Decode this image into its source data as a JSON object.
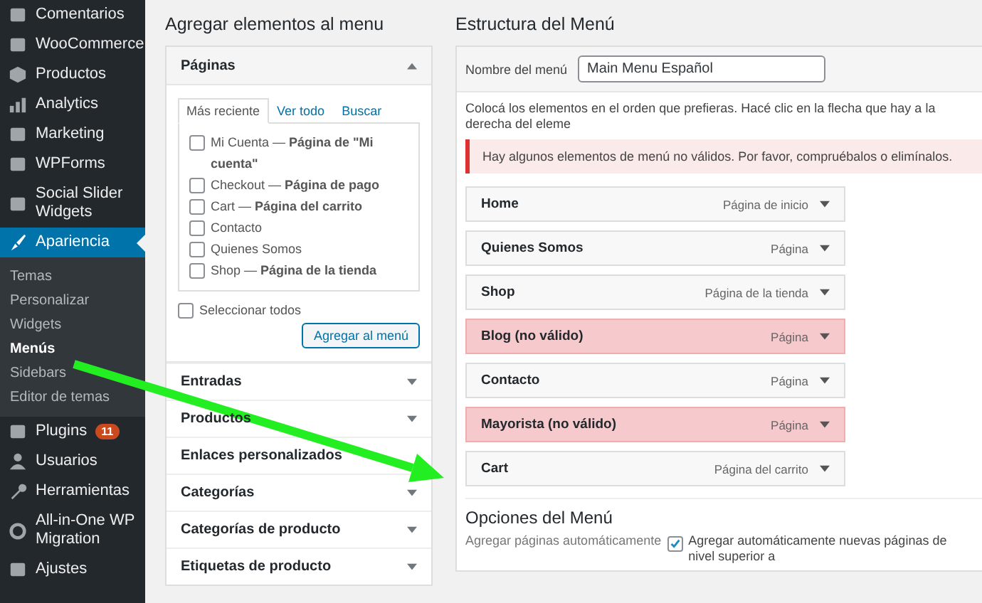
{
  "sidebar": {
    "items": [
      {
        "label": "Comentarios",
        "selected": false
      },
      {
        "label": "WooCommerce",
        "selected": false
      },
      {
        "label": "Productos",
        "selected": false
      },
      {
        "label": "Analytics",
        "selected": false
      },
      {
        "label": "Marketing",
        "selected": false
      },
      {
        "label": "WPForms",
        "selected": false
      },
      {
        "label": "Social Slider Widgets",
        "selected": false
      },
      {
        "label": "Apariencia",
        "selected": true,
        "children": [
          {
            "label": "Temas",
            "selected": false
          },
          {
            "label": "Personalizar",
            "selected": false
          },
          {
            "label": "Widgets",
            "selected": false
          },
          {
            "label": "Menús",
            "selected": true
          },
          {
            "label": "Sidebars",
            "selected": false
          },
          {
            "label": "Editor de temas",
            "selected": false
          }
        ]
      },
      {
        "label": "Plugins",
        "selected": false,
        "badge": "11"
      },
      {
        "label": "Usuarios",
        "selected": false
      },
      {
        "label": "Herramientas",
        "selected": false
      },
      {
        "label": "All-in-One WP Migration",
        "selected": false
      },
      {
        "label": "Ajustes",
        "selected": false
      }
    ]
  },
  "add_panel": {
    "title": "Agregar elementos al menu",
    "sections": [
      {
        "title": "Páginas",
        "expanded": true,
        "toggle": true,
        "tabs": [
          {
            "label": "Más reciente",
            "selected": true
          },
          {
            "label": "Ver todo",
            "selected": false
          },
          {
            "label": "Buscar",
            "selected": false
          }
        ],
        "items": [
          {
            "label": "Mi Cuenta — **Página de \"Mi cuenta\"**",
            "checked": false
          },
          {
            "label": "Checkout — **Página de pago**",
            "checked": false
          },
          {
            "label": "Cart — **Página del carrito**",
            "checked": false
          },
          {
            "label": "Contacto",
            "checked": false
          },
          {
            "label": "Quienes Somos",
            "checked": false
          },
          {
            "label": "Shop — **Página de la tienda**",
            "checked": false
          }
        ],
        "select_all": {
          "label": "Seleccionar todos",
          "checked": false
        },
        "button": "Agregar al menú"
      },
      {
        "title": "Entradas",
        "expanded": false,
        "toggle": true
      },
      {
        "title": "Productos",
        "expanded": false,
        "toggle": true
      },
      {
        "title": "Enlaces personalizados",
        "expanded": false,
        "toggle": false
      },
      {
        "title": "Categorías",
        "expanded": false,
        "toggle": true
      },
      {
        "title": "Categorías de producto",
        "expanded": false,
        "toggle": true
      },
      {
        "title": "Etiquetas de producto",
        "expanded": false,
        "toggle": true
      }
    ]
  },
  "structure": {
    "title": "Estructura del Menú",
    "name_label": "Nombre del menú",
    "name_value": "Main Menu Español",
    "instructions": "Colocá los elementos en el orden que prefieras. Hacé clic en la flecha que hay a la derecha del eleme",
    "notice": "Hay algunos elementos de menú no válidos. Por favor, compruébalos o elimínalos.",
    "items": [
      {
        "title": "Home",
        "type": "Página de inicio",
        "invalid": false
      },
      {
        "title": "Quienes Somos",
        "type": "Página",
        "invalid": false
      },
      {
        "title": "Shop",
        "type": "Página de la tienda",
        "invalid": false
      },
      {
        "title": "Blog (no válido)",
        "type": "Página",
        "invalid": true
      },
      {
        "title": "Contacto",
        "type": "Página",
        "invalid": false
      },
      {
        "title": "Mayorista (no válido)",
        "type": "Página",
        "invalid": true
      },
      {
        "title": "Cart",
        "type": "Página del carrito",
        "invalid": false
      }
    ],
    "options_title": "Opciones del Menú",
    "option": {
      "label": "Agregar páginas automáticamente",
      "checked": true,
      "description": "Agregar automáticamente nuevas páginas de nivel superior a"
    }
  }
}
